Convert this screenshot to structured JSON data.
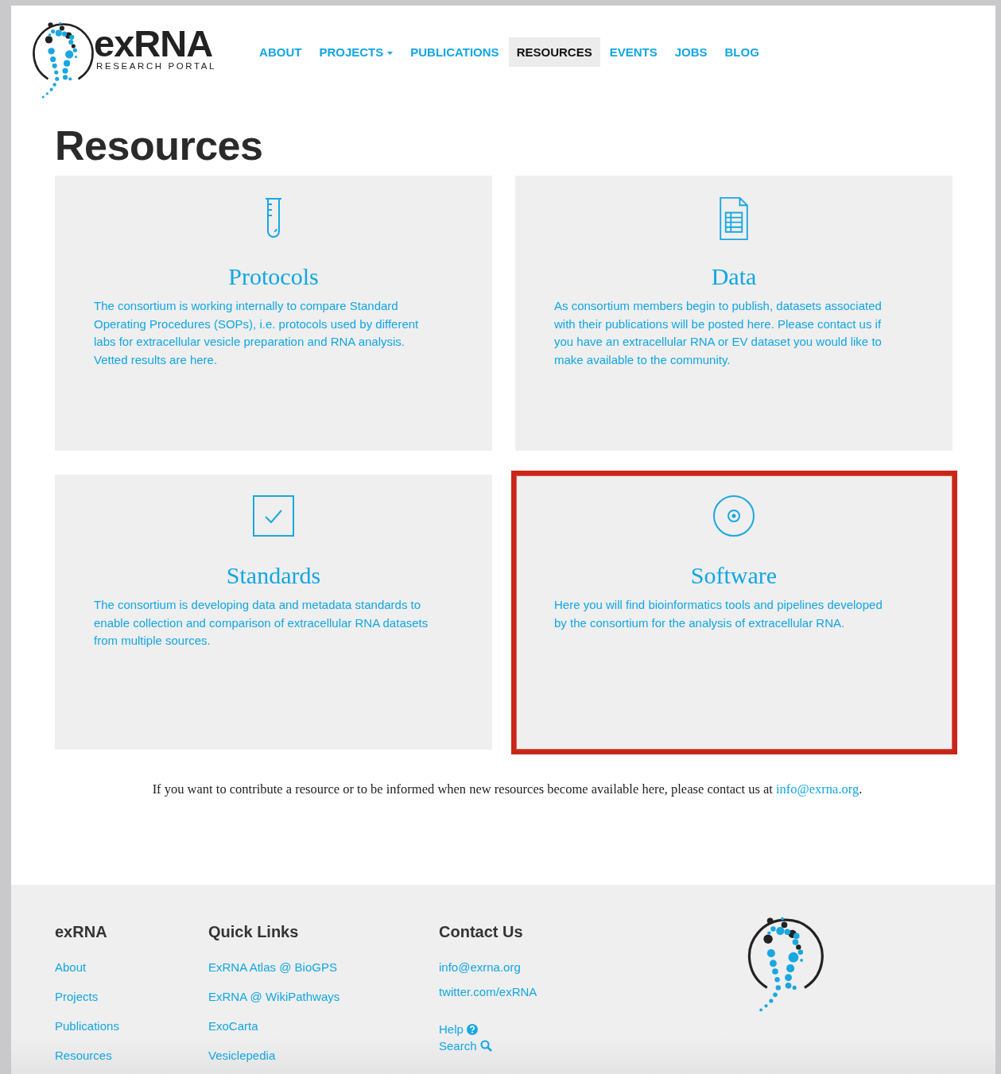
{
  "header": {
    "logo": {
      "wordmark": "exRNA",
      "tagline": "RESEARCH PORTAL"
    },
    "nav": [
      {
        "label": "ABOUT",
        "selected": false,
        "dropdown": false
      },
      {
        "label": "PROJECTS",
        "selected": false,
        "dropdown": true
      },
      {
        "label": "PUBLICATIONS",
        "selected": false,
        "dropdown": false
      },
      {
        "label": "RESOURCES",
        "selected": true,
        "dropdown": false
      },
      {
        "label": "EVENTS",
        "selected": false,
        "dropdown": false
      },
      {
        "label": "JOBS",
        "selected": false,
        "dropdown": false
      },
      {
        "label": "BLOG",
        "selected": false,
        "dropdown": false
      }
    ]
  },
  "page_title": "Resources",
  "cards": [
    {
      "kind": "test-tube",
      "title": "Protocols",
      "text": "The consortium is working internally to compare Standard Operating Procedures (SOPs), i.e. protocols used by different labs for extracellular vesicle preparation and RNA analysis. Vetted results are here.",
      "highlighted": false
    },
    {
      "kind": "spreadsheet",
      "title": "Data",
      "text": "As consortium members begin to publish, datasets associated with their publications will be posted here. Please contact us if you have an extracellular RNA or EV dataset you would like to make available to the community.",
      "highlighted": false
    },
    {
      "kind": "checkbox",
      "title": "Standards",
      "text": "The consortium is developing data and metadata standards to enable collection and comparison of extracellular RNA datasets from multiple sources.",
      "highlighted": false
    },
    {
      "kind": "disc",
      "title": "Software",
      "text": "Here you will find bioinformatics tools and pipelines developed by the consortium for the analysis of extracellular RNA.",
      "highlighted": true
    }
  ],
  "contribute": {
    "text": "If you want to contribute a resource or to be informed when new resources become available here, please contact us at",
    "link": "info@exrna.org",
    "end": "."
  },
  "footer": {
    "columns": [
      {
        "heading": "exRNA",
        "links": [
          {
            "label": "About"
          },
          {
            "label": "Projects"
          },
          {
            "label": "Publications"
          },
          {
            "label": "Resources"
          }
        ]
      },
      {
        "heading": "Quick Links",
        "links": [
          {
            "label": "ExRNA Atlas @ BioGPS"
          },
          {
            "label": "ExRNA @ WikiPathways"
          },
          {
            "label": "ExoCarta"
          },
          {
            "label": "Vesiclepedia"
          }
        ]
      },
      {
        "heading": "Contact Us",
        "links": [
          {
            "label": "info@exrna.org"
          },
          {
            "label": "twitter.com/exRNA"
          },
          {
            "label": "Help",
            "kind": "help"
          },
          {
            "label": "Search",
            "kind": "search"
          }
        ]
      }
    ]
  }
}
